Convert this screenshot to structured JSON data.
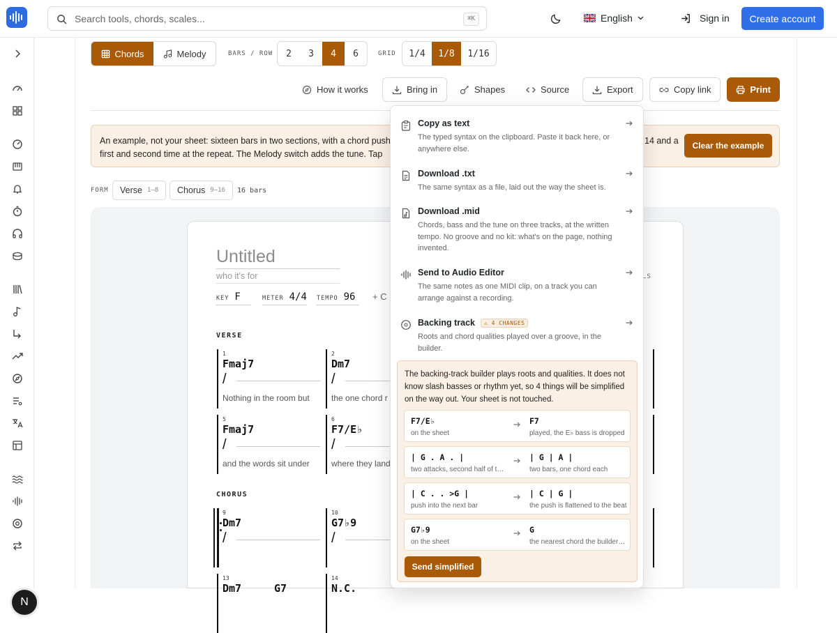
{
  "search": {
    "placeholder": "Search tools, chords, scales...",
    "shortcut": "⌘K"
  },
  "header": {
    "language": "English",
    "sign_in": "Sign in",
    "create_account": "Create account"
  },
  "sidebar": {
    "avatar_initial": "N"
  },
  "mode": {
    "chords": "Chords",
    "melody": "Melody",
    "active": "Chords"
  },
  "bars_per_row": {
    "label": "BARS / ROW",
    "options": [
      "2",
      "3",
      "4",
      "6"
    ],
    "selected": "4"
  },
  "grid": {
    "label": "GRID",
    "options": [
      "1/4",
      "1/8",
      "1/16"
    ],
    "selected": "1/8"
  },
  "toolbar": {
    "how_it_works": "How it works",
    "bring_in": "Bring in",
    "shapes": "Shapes",
    "source": "Source",
    "export": "Export",
    "copy_link": "Copy link",
    "print": "Print"
  },
  "banner": {
    "text": "An example, not your sheet: sixteen bars in two sections, with a chord push first and second time at the repeat. The Melody switch adds the tune. Tap",
    "text_right": "14 and a",
    "clear": "Clear the example"
  },
  "form": {
    "label": "FORM",
    "sections": [
      {
        "name": "Verse",
        "range": "1–8"
      },
      {
        "name": "Chorus",
        "range": "9–16"
      }
    ],
    "bars": "16 bars"
  },
  "sheet": {
    "title_placeholder": "Untitled",
    "subtitle_placeholder": "who it's for",
    "key_label": "KEY",
    "key": "F",
    "meter_label": "METER",
    "meter": "4/4",
    "tempo_label": "TEMPO",
    "tempo": "96",
    "more": "+ C",
    "clip_label": "LS",
    "sections": [
      {
        "name": "VERSE",
        "bars": [
          {
            "n": "1",
            "chord": "Fmaj7",
            "lyric": "Nothing in the room but"
          },
          {
            "n": "2",
            "chord": "Dm7",
            "lyric": "the one chord r"
          },
          {
            "n": "5",
            "chord": "Fmaj7",
            "lyric": "and the words sit under"
          },
          {
            "n": "6",
            "chord": "F7/E♭",
            "lyric": "where they land"
          }
        ]
      },
      {
        "name": "CHORUS",
        "bars": [
          {
            "n": "9",
            "chord": "Dm7",
            "lyric": ""
          },
          {
            "n": "10",
            "chord": "G7♭9",
            "lyric": ""
          },
          {
            "n": "13",
            "chord": "Dm7",
            "lyric": ""
          },
          {
            "n": "14",
            "chord": "N.C.",
            "lyric": ""
          }
        ]
      }
    ],
    "partial_chord": "G7"
  },
  "dropdown": {
    "items": [
      {
        "title": "Copy as text",
        "desc": "The typed syntax on the clipboard. Paste it back here, or anywhere else."
      },
      {
        "title": "Download .txt",
        "desc": "The same syntax as a file, laid out the way the sheet is."
      },
      {
        "title": "Download .mid",
        "desc": "Chords, bass and the tune on three tracks, at the written tempo. No groove and no kit: what's on the page, nothing invented."
      },
      {
        "title": "Send to Audio Editor",
        "desc": "The same notes as one MIDI clip, on a track you can arrange against a recording."
      },
      {
        "title": "Backing track",
        "badge": "4 CHANGES",
        "desc": "Roots and chord qualities played over a groove, in the builder."
      }
    ],
    "note": {
      "explain": "The backing-track builder plays roots and qualities. It does not know slash basses or rhythm yet, so 4 things will be simplified on the way out. Your sheet is not touched.",
      "changes": [
        {
          "from": "F7/E♭",
          "from_desc": "on the sheet",
          "to": "F7",
          "to_desc": "played, the E♭ bass is dropped"
        },
        {
          "from": "| G . A . |",
          "from_desc": "two attacks, second half of the bar",
          "to": "| G | A |",
          "to_desc": "two bars, one chord each"
        },
        {
          "from": "| C . . >G |",
          "from_desc": "push into the next bar",
          "to": "| C | G |",
          "to_desc": "the push is flattened to the beat"
        },
        {
          "from": "G7♭9",
          "from_desc": "on the sheet",
          "to": "G",
          "to_desc": "the nearest chord the builder knows"
        }
      ],
      "send": "Send simplified"
    }
  },
  "colors": {
    "accent": "#a85a06",
    "brand": "#2f6fea",
    "note_bg": "#fbf0e6"
  }
}
